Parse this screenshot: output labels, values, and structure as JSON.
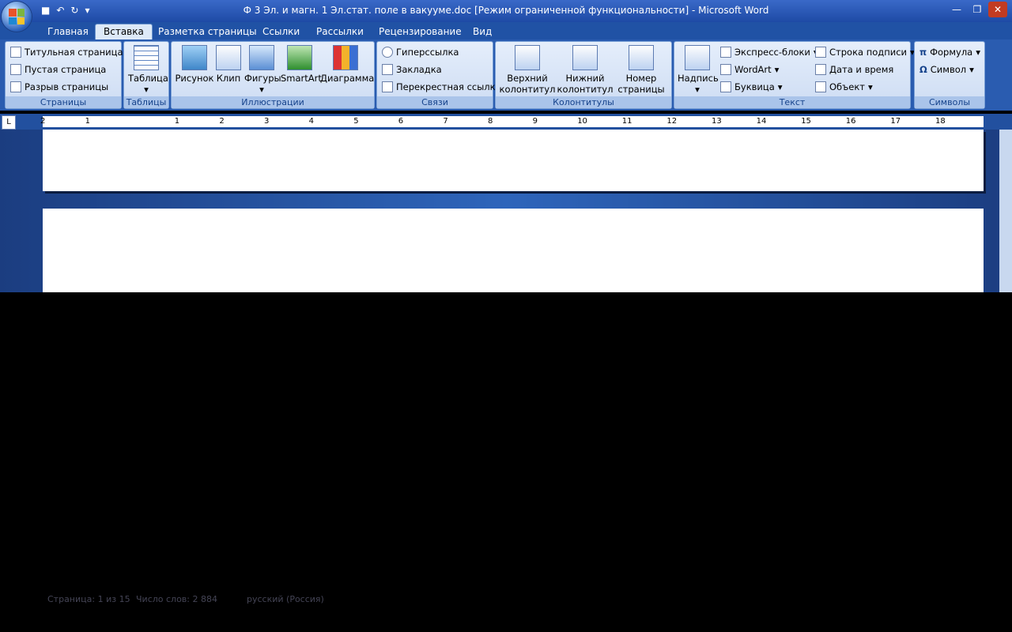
{
  "titlebar": {
    "title": "Ф 3 Эл. и магн. 1 Эл.стат. поле в вакууме.doc [Режим ограниченной функциональности] - Microsoft Word",
    "save_icon": "save-icon",
    "undo_icon": "undo-icon",
    "redo_icon": "redo-icon"
  },
  "tabs": [
    "Главная",
    "Вставка",
    "Разметка страницы",
    "Ссылки",
    "Рассылки",
    "Рецензирование",
    "Вид"
  ],
  "ribbon": {
    "pages": {
      "label": "Страницы",
      "items": [
        "Титульная страница",
        "Пустая страница",
        "Разрыв страницы"
      ]
    },
    "tables": {
      "label": "Таблицы",
      "items": [
        "Таблица"
      ]
    },
    "illustrations": {
      "label": "Иллюстрации",
      "items": [
        "Рисунок",
        "Клип",
        "Фигуры",
        "SmartArt",
        "Диаграмма"
      ]
    },
    "links": {
      "label": "Связи",
      "items": [
        "Гиперссылка",
        "Закладка",
        "Перекрестная ссылка"
      ]
    },
    "headers": {
      "label": "Колонтитулы",
      "items": [
        {
          "line1": "Верхний",
          "line2": "колонтитул"
        },
        {
          "line1": "Нижний",
          "line2": "колонтитул"
        },
        {
          "line1": "Номер",
          "line2": "страницы"
        }
      ]
    },
    "text": {
      "label": "Текст",
      "caption": "Надпись",
      "items": [
        "Экспресс-блоки",
        "WordArt",
        "Буквица",
        "Строка подписи",
        "Дата и время",
        "Объект"
      ]
    },
    "symbols": {
      "label": "Символы",
      "items": [
        "Формула",
        "Символ"
      ]
    }
  },
  "ruler": {
    "ticks": [
      "2",
      "1",
      "",
      "1",
      "2",
      "3",
      "4",
      "5",
      "6",
      "7",
      "8",
      "9",
      "10",
      "11",
      "12",
      "13",
      "14",
      "15",
      "16",
      "17",
      "18"
    ]
  },
  "statusbar": {
    "page": "Страница: 1 из 15",
    "words": "Число слов: 2 884",
    "lang": "русский (Россия)"
  }
}
